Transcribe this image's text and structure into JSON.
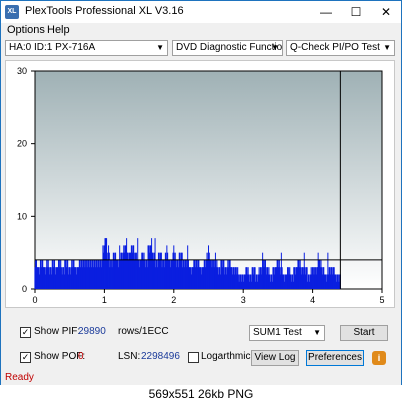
{
  "window": {
    "title": "PlexTools Professional XL V3.16",
    "icon_label": "XL"
  },
  "titlebar_buttons": {
    "minimize": "—",
    "maximize": "☐",
    "close": "✕"
  },
  "menu": {
    "options": "Options",
    "help": "Help"
  },
  "toolbar": {
    "drive": "HA:0 ID:1  PX-716A",
    "function": "DVD Diagnostic Functions",
    "test": "Q-Check PI/PO Test"
  },
  "chart_data": {
    "type": "bar",
    "x_ticks": [
      "0",
      "1",
      "2",
      "3",
      "4",
      "5"
    ],
    "y_ticks": [
      "0",
      "10",
      "20",
      "30"
    ],
    "xlim": [
      0,
      5
    ],
    "ylim": [
      0,
      30
    ],
    "threshold_line": 4,
    "end_marker_x": 4.4,
    "bars": [
      {
        "x": 0.02,
        "y": 4
      },
      {
        "x": 0.05,
        "y": 3
      },
      {
        "x": 0.1,
        "y": 4
      },
      {
        "x": 0.14,
        "y": 3
      },
      {
        "x": 0.18,
        "y": 4
      },
      {
        "x": 0.22,
        "y": 3
      },
      {
        "x": 0.27,
        "y": 4
      },
      {
        "x": 0.3,
        "y": 3
      },
      {
        "x": 0.35,
        "y": 4
      },
      {
        "x": 0.4,
        "y": 3
      },
      {
        "x": 0.45,
        "y": 4
      },
      {
        "x": 0.5,
        "y": 3
      },
      {
        "x": 0.55,
        "y": 4
      },
      {
        "x": 0.6,
        "y": 3
      },
      {
        "x": 0.65,
        "y": 4
      },
      {
        "x": 0.7,
        "y": 4
      },
      {
        "x": 0.75,
        "y": 4
      },
      {
        "x": 0.8,
        "y": 4
      },
      {
        "x": 0.85,
        "y": 4
      },
      {
        "x": 0.9,
        "y": 4
      },
      {
        "x": 0.95,
        "y": 4
      },
      {
        "x": 1.0,
        "y": 6
      },
      {
        "x": 1.02,
        "y": 7
      },
      {
        "x": 1.05,
        "y": 5
      },
      {
        "x": 1.1,
        "y": 4
      },
      {
        "x": 1.15,
        "y": 5
      },
      {
        "x": 1.2,
        "y": 4
      },
      {
        "x": 1.25,
        "y": 5
      },
      {
        "x": 1.3,
        "y": 6
      },
      {
        "x": 1.35,
        "y": 5
      },
      {
        "x": 1.4,
        "y": 6
      },
      {
        "x": 1.45,
        "y": 5
      },
      {
        "x": 1.5,
        "y": 4
      },
      {
        "x": 1.55,
        "y": 5
      },
      {
        "x": 1.6,
        "y": 4
      },
      {
        "x": 1.65,
        "y": 6
      },
      {
        "x": 1.7,
        "y": 5
      },
      {
        "x": 1.75,
        "y": 4
      },
      {
        "x": 1.8,
        "y": 5
      },
      {
        "x": 1.85,
        "y": 4
      },
      {
        "x": 1.9,
        "y": 5
      },
      {
        "x": 1.95,
        "y": 4
      },
      {
        "x": 2.0,
        "y": 5
      },
      {
        "x": 2.05,
        "y": 4
      },
      {
        "x": 2.1,
        "y": 5
      },
      {
        "x": 2.15,
        "y": 4
      },
      {
        "x": 2.2,
        "y": 4
      },
      {
        "x": 2.25,
        "y": 3
      },
      {
        "x": 2.3,
        "y": 4
      },
      {
        "x": 2.35,
        "y": 4
      },
      {
        "x": 2.4,
        "y": 3
      },
      {
        "x": 2.45,
        "y": 4
      },
      {
        "x": 2.5,
        "y": 5
      },
      {
        "x": 2.55,
        "y": 4
      },
      {
        "x": 2.6,
        "y": 4
      },
      {
        "x": 2.65,
        "y": 3
      },
      {
        "x": 2.7,
        "y": 4
      },
      {
        "x": 2.75,
        "y": 3
      },
      {
        "x": 2.8,
        "y": 4
      },
      {
        "x": 2.85,
        "y": 3
      },
      {
        "x": 2.9,
        "y": 3
      },
      {
        "x": 2.95,
        "y": 2
      },
      {
        "x": 3.0,
        "y": 2
      },
      {
        "x": 3.05,
        "y": 3
      },
      {
        "x": 3.1,
        "y": 2
      },
      {
        "x": 3.15,
        "y": 3
      },
      {
        "x": 3.2,
        "y": 2
      },
      {
        "x": 3.25,
        "y": 3
      },
      {
        "x": 3.3,
        "y": 4
      },
      {
        "x": 3.35,
        "y": 3
      },
      {
        "x": 3.4,
        "y": 2
      },
      {
        "x": 3.45,
        "y": 3
      },
      {
        "x": 3.5,
        "y": 4
      },
      {
        "x": 3.55,
        "y": 3
      },
      {
        "x": 3.6,
        "y": 2
      },
      {
        "x": 3.65,
        "y": 3
      },
      {
        "x": 3.7,
        "y": 2
      },
      {
        "x": 3.75,
        "y": 3
      },
      {
        "x": 3.8,
        "y": 4
      },
      {
        "x": 3.85,
        "y": 3
      },
      {
        "x": 3.9,
        "y": 3
      },
      {
        "x": 3.95,
        "y": 2
      },
      {
        "x": 4.0,
        "y": 3
      },
      {
        "x": 4.05,
        "y": 3
      },
      {
        "x": 4.1,
        "y": 4
      },
      {
        "x": 4.15,
        "y": 3
      },
      {
        "x": 4.2,
        "y": 2
      },
      {
        "x": 4.25,
        "y": 3
      },
      {
        "x": 4.3,
        "y": 3
      },
      {
        "x": 4.35,
        "y": 2
      }
    ],
    "spikes": [
      {
        "x": 1.02,
        "y": 7
      },
      {
        "x": 1.06,
        "y": 6
      },
      {
        "x": 1.22,
        "y": 6
      },
      {
        "x": 1.32,
        "y": 7
      },
      {
        "x": 1.42,
        "y": 6
      },
      {
        "x": 1.48,
        "y": 7
      },
      {
        "x": 1.68,
        "y": 7
      },
      {
        "x": 1.73,
        "y": 7
      },
      {
        "x": 1.9,
        "y": 6
      },
      {
        "x": 2.0,
        "y": 6
      },
      {
        "x": 2.2,
        "y": 6
      },
      {
        "x": 2.5,
        "y": 6
      },
      {
        "x": 2.6,
        "y": 5
      },
      {
        "x": 3.28,
        "y": 5
      },
      {
        "x": 3.55,
        "y": 5
      },
      {
        "x": 3.88,
        "y": 5
      },
      {
        "x": 4.08,
        "y": 5
      },
      {
        "x": 4.22,
        "y": 5
      }
    ]
  },
  "colors": {
    "plot_bg_top": "#9fb1b5",
    "plot_bg_bottom": "#ffffff",
    "bars": "#0a1fe0",
    "threshold": "#000000",
    "status": "#c00000"
  },
  "controls": {
    "show_pif_label": "Show PIF:",
    "pif_value": "29890",
    "rows_label": "rows/1ECC",
    "show_pof_label": "Show POF:",
    "pof_value": "0",
    "lsn_label": "LSN:",
    "lsn_value": "2298496",
    "logarithmic_label": "Logarthmic",
    "sum_select": "SUM1 Test",
    "start_button": "Start",
    "viewlog_button": "View Log",
    "preferences_button": "Preferences",
    "info_icon": "i",
    "check_mark": "✓"
  },
  "status": {
    "text": "Ready"
  },
  "caption": {
    "text": "569x551  26kb  PNG"
  }
}
